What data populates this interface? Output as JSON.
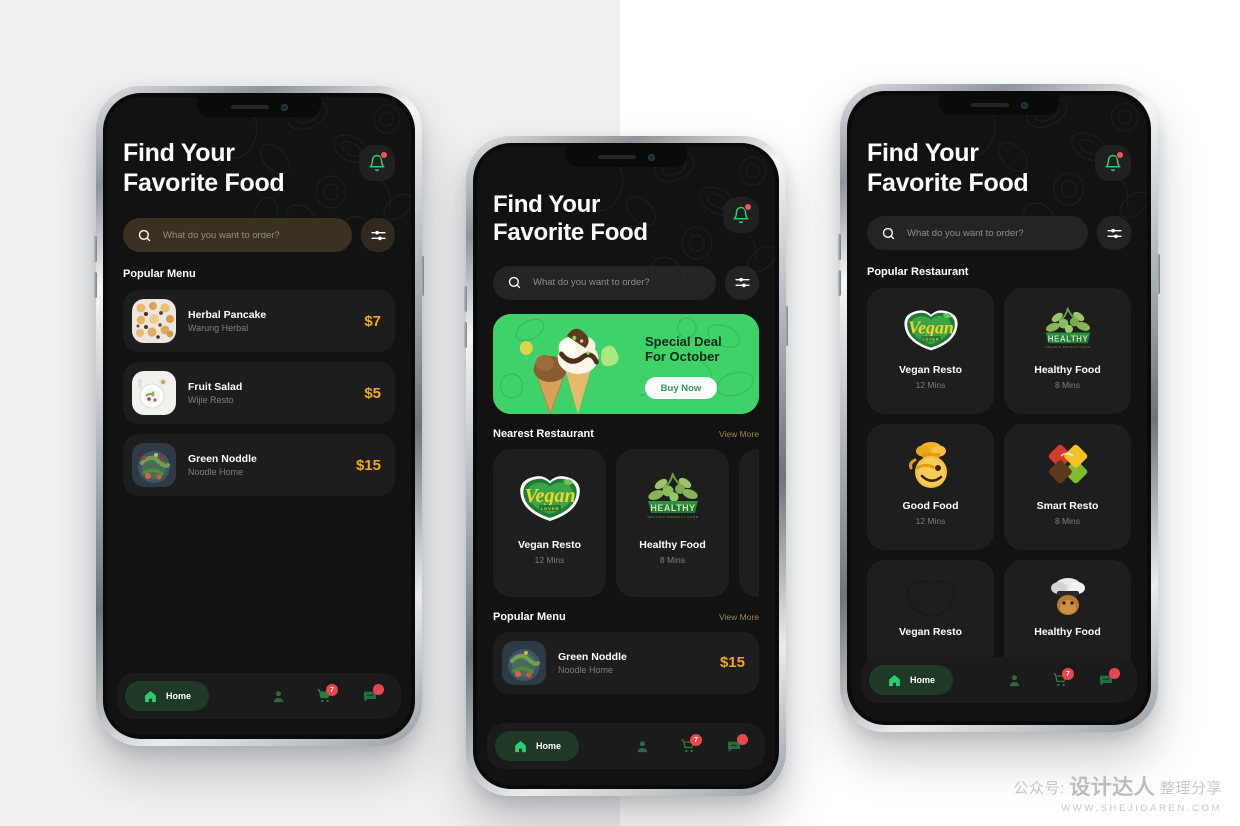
{
  "background": {
    "left_color": "#f0f1f2",
    "right_color": "#ffffff"
  },
  "watermark": {
    "line1_prefix": "公众号:",
    "line1_brand": "设计达人",
    "line1_suffix": "整理分享",
    "line2": "WWW.SHEJIDAREN.COM"
  },
  "theme": {
    "accent_green": "#2ecc71",
    "price_amber": "#f0a81e",
    "badge_red": "#e8474c",
    "screen_bg": "#121212",
    "card_bg": "#1d1d1d",
    "muted_text": "#7e7e7e",
    "view_more": "#9e8456",
    "banner_green": "#3fd16a"
  },
  "common": {
    "title_line1": "Find Your",
    "title_line2": "Favorite Food",
    "search_placeholder": "What do you want to order?",
    "search_value": "",
    "bell_icon": "bell-icon",
    "filter_icon": "filter-sliders-icon",
    "search_icon": "search-icon"
  },
  "tabbar": {
    "items": [
      {
        "name": "home",
        "icon": "home-icon",
        "label": "Home",
        "active": true,
        "badge": null
      },
      {
        "name": "profile",
        "icon": "user-icon",
        "label": "",
        "active": false,
        "badge": null
      },
      {
        "name": "cart",
        "icon": "cart-icon",
        "label": "",
        "active": false,
        "badge": "7"
      },
      {
        "name": "messages",
        "icon": "chat-icon",
        "label": "",
        "active": false,
        "badge": ""
      }
    ]
  },
  "screen1": {
    "search_style": "warm",
    "section_title": "Popular Menu",
    "menu_items": [
      {
        "name": "Herbal Pancake",
        "restaurant": "Warung Herbal",
        "price": "$7",
        "thumb": "pancake-photo"
      },
      {
        "name": "Fruit Salad",
        "restaurant": "Wijie Resto",
        "price": "$5",
        "thumb": "fruit-salad-photo"
      },
      {
        "name": "Green Noddle",
        "restaurant": "Noodle Home",
        "price": "$15",
        "thumb": "green-noodle-photo"
      }
    ]
  },
  "screen2": {
    "search_style": "dark",
    "banner": {
      "title": "Special Deal For October",
      "button_label": "Buy Now",
      "image": "ice-cream-cones-photo"
    },
    "nearest": {
      "title": "Nearest Restaurant",
      "view_more": "View More",
      "cards": [
        {
          "name": "Vegan Resto",
          "time": "12 Mins",
          "logo": "vegan-lover-logo"
        },
        {
          "name": "Healthy Food",
          "time": "8 Mins",
          "logo": "healthy-olive-logo"
        },
        {
          "name": "",
          "time": "",
          "logo": "partial-card"
        }
      ]
    },
    "popular": {
      "title": "Popular Menu",
      "view_more": "View More",
      "items": [
        {
          "name": "Green Noddle",
          "restaurant": "Noodle Home",
          "price": "$15",
          "thumb": "green-noodle-photo"
        }
      ]
    }
  },
  "screen3": {
    "search_style": "dark",
    "section_title": "Popular Restaurant",
    "cards": [
      {
        "name": "Vegan Resto",
        "time": "12 Mins",
        "logo": "vegan-lover-logo"
      },
      {
        "name": "Healthy Food",
        "time": "8 Mins",
        "logo": "healthy-olive-logo"
      },
      {
        "name": "Good Food",
        "time": "12 Mins",
        "logo": "good-food-chef-logo"
      },
      {
        "name": "Smart Resto",
        "time": "8 Mins",
        "logo": "smart-resto-diamond-logo"
      },
      {
        "name": "Vegan Resto",
        "time": "",
        "logo": "vegan-lover-logo"
      },
      {
        "name": "Healthy Food",
        "time": "",
        "logo": "chef-mascot-logo"
      }
    ]
  }
}
